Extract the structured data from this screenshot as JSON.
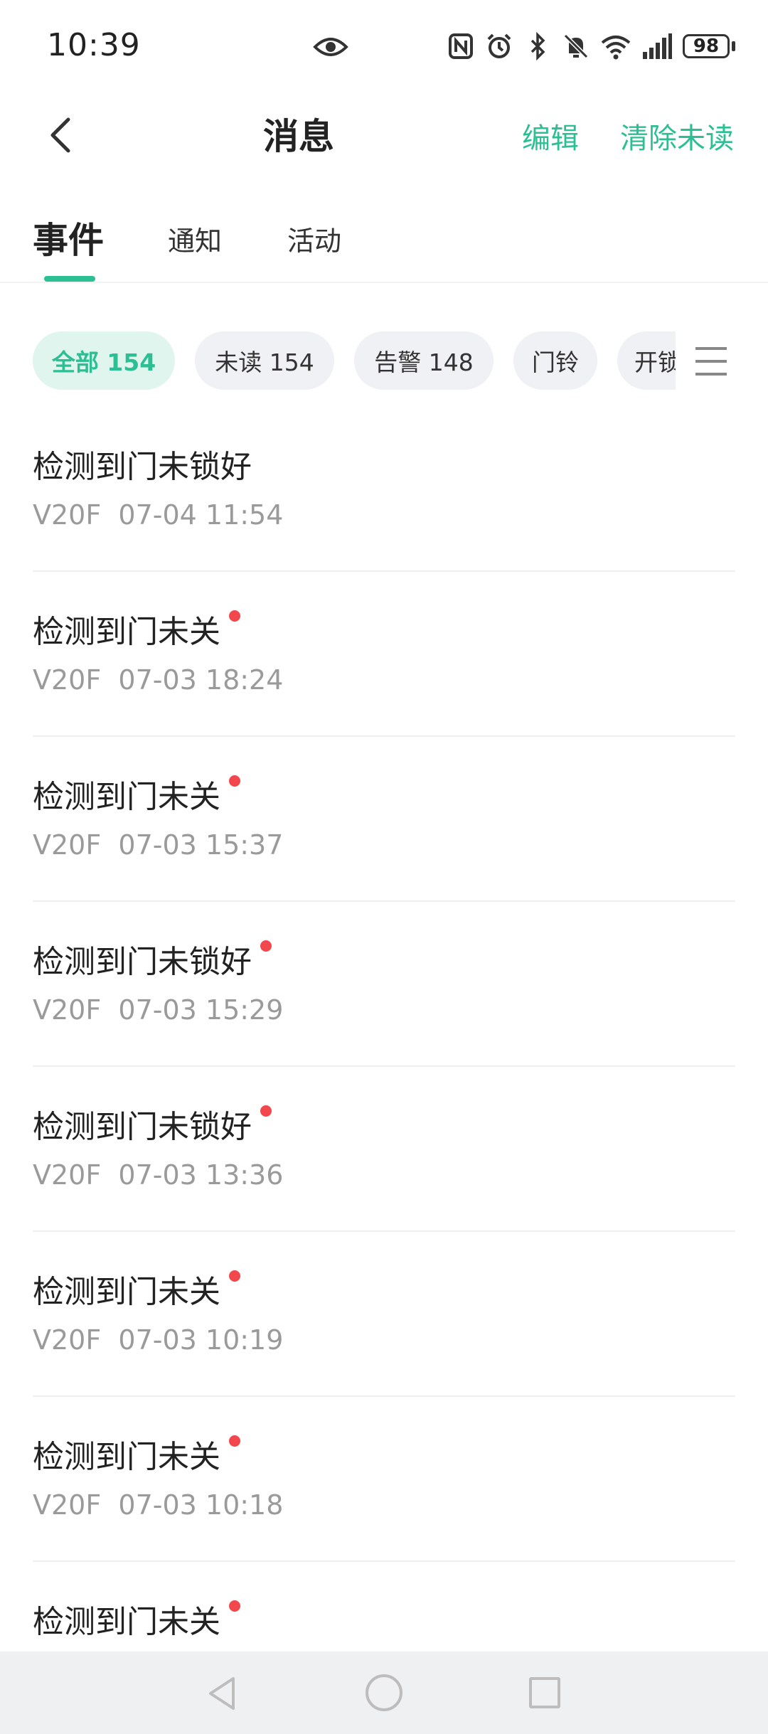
{
  "status_bar": {
    "time": "10:39",
    "battery": "98"
  },
  "header": {
    "title": "消息",
    "edit_label": "编辑",
    "clear_unread_label": "清除未读"
  },
  "tabs": [
    {
      "label": "事件",
      "active": true
    },
    {
      "label": "通知",
      "active": false
    },
    {
      "label": "活动",
      "active": false
    }
  ],
  "filters": [
    {
      "label": "全部 154",
      "active": true
    },
    {
      "label": "未读 154",
      "active": false
    },
    {
      "label": "告警 148",
      "active": false
    },
    {
      "label": "门铃",
      "active": false
    },
    {
      "label": "开锁",
      "active": false
    }
  ],
  "messages": [
    {
      "title": "检测到门未锁好",
      "device": "V20F",
      "time": "07-04 11:54",
      "unread": false
    },
    {
      "title": "检测到门未关",
      "device": "V20F",
      "time": "07-03 18:24",
      "unread": true
    },
    {
      "title": "检测到门未关",
      "device": "V20F",
      "time": "07-03 15:37",
      "unread": true
    },
    {
      "title": "检测到门未锁好",
      "device": "V20F",
      "time": "07-03 15:29",
      "unread": true
    },
    {
      "title": "检测到门未锁好",
      "device": "V20F",
      "time": "07-03 13:36",
      "unread": true
    },
    {
      "title": "检测到门未关",
      "device": "V20F",
      "time": "07-03 10:19",
      "unread": true
    },
    {
      "title": "检测到门未关",
      "device": "V20F",
      "time": "07-03 10:18",
      "unread": true
    },
    {
      "title": "检测到门未关",
      "device": "",
      "time": "",
      "unread": true
    }
  ],
  "colors": {
    "accent": "#2bbf93",
    "unread_dot": "#f2474c"
  }
}
